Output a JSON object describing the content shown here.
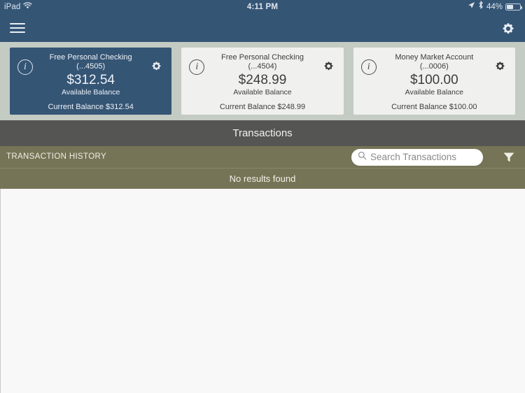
{
  "statusbar": {
    "carrier": "iPad",
    "wifi_icon": "wifi-icon",
    "time": "4:11 PM",
    "location_icon": "location-arrow-icon",
    "bluetooth_icon": "bluetooth-icon",
    "battery_percent": "44%"
  },
  "navbar": {
    "menu_icon": "hamburger-menu-icon",
    "settings_icon": "gear-icon",
    "accent_color": "#355575"
  },
  "accounts": {
    "background_color": "#c3cbc3",
    "cards": [
      {
        "name": "Free Personal Checking",
        "mask": "(...4505)",
        "amount": "$312.54",
        "available_label": "Available Balance",
        "current_label": "Current Balance $312.54",
        "selected": true,
        "info_icon": "info-circle-icon",
        "gear_icon": "gear-icon"
      },
      {
        "name": "Free Personal Checking",
        "mask": "(...4504)",
        "amount": "$248.99",
        "available_label": "Available Balance",
        "current_label": "Current Balance $248.99",
        "selected": false,
        "info_icon": "info-circle-icon",
        "gear_icon": "gear-icon"
      },
      {
        "name": "Money Market Account",
        "mask": "(...0006)",
        "amount": "$100.00",
        "available_label": "Available Balance",
        "current_label": "Current Balance $100.00",
        "selected": false,
        "info_icon": "info-circle-icon",
        "gear_icon": "gear-icon"
      }
    ]
  },
  "section": {
    "title": "Transactions",
    "title_bar_color": "#555553"
  },
  "history": {
    "label": "TRANSACTION HISTORY",
    "bar_color": "#767456",
    "search": {
      "placeholder": "Search Transactions",
      "value": "",
      "icon": "search-icon"
    },
    "filter_icon": "filter-funnel-icon"
  },
  "results": {
    "empty_message": "No results found"
  }
}
